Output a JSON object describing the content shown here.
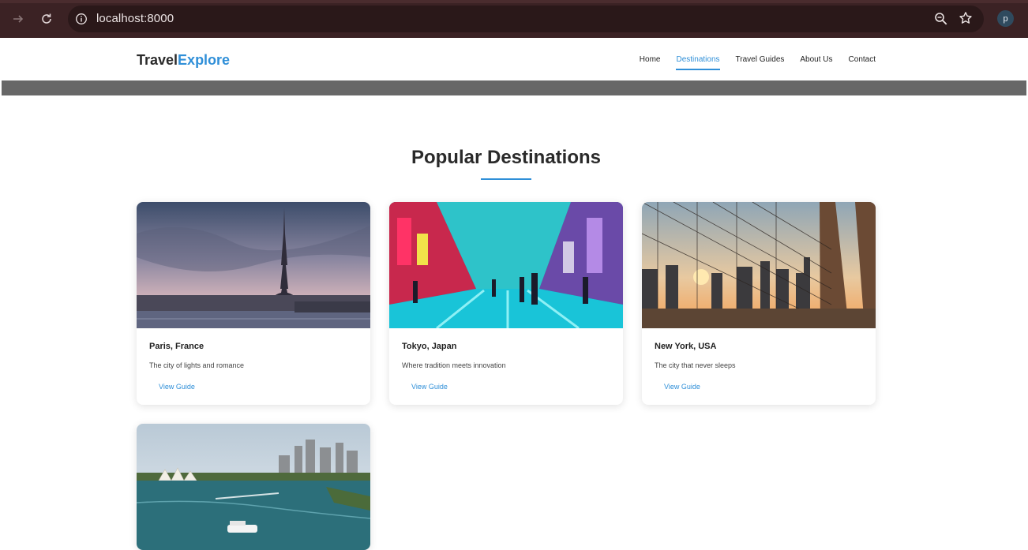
{
  "browser": {
    "url": "localhost:8000",
    "profile_initial": "p",
    "icons": [
      "forward-icon",
      "reload-icon",
      "info-icon",
      "zoom-icon",
      "star-icon"
    ]
  },
  "site": {
    "logo_part1": "Travel",
    "logo_part2": "Explore",
    "accent_color": "#2f8fd8",
    "nav": [
      {
        "label": "Home",
        "active": false
      },
      {
        "label": "Destinations",
        "active": true
      },
      {
        "label": "Travel Guides",
        "active": false
      },
      {
        "label": "About Us",
        "active": false
      },
      {
        "label": "Contact",
        "active": false
      }
    ]
  },
  "section": {
    "title": "Popular Destinations"
  },
  "destinations": [
    {
      "name": "Paris, France",
      "description": "The city of lights and romance",
      "link": "View Guide"
    },
    {
      "name": "Tokyo, Japan",
      "description": "Where tradition meets innovation",
      "link": "View Guide"
    },
    {
      "name": "New York, USA",
      "description": "The city that never sleeps",
      "link": "View Guide"
    },
    {
      "name": "",
      "description": "",
      "link": ""
    }
  ]
}
